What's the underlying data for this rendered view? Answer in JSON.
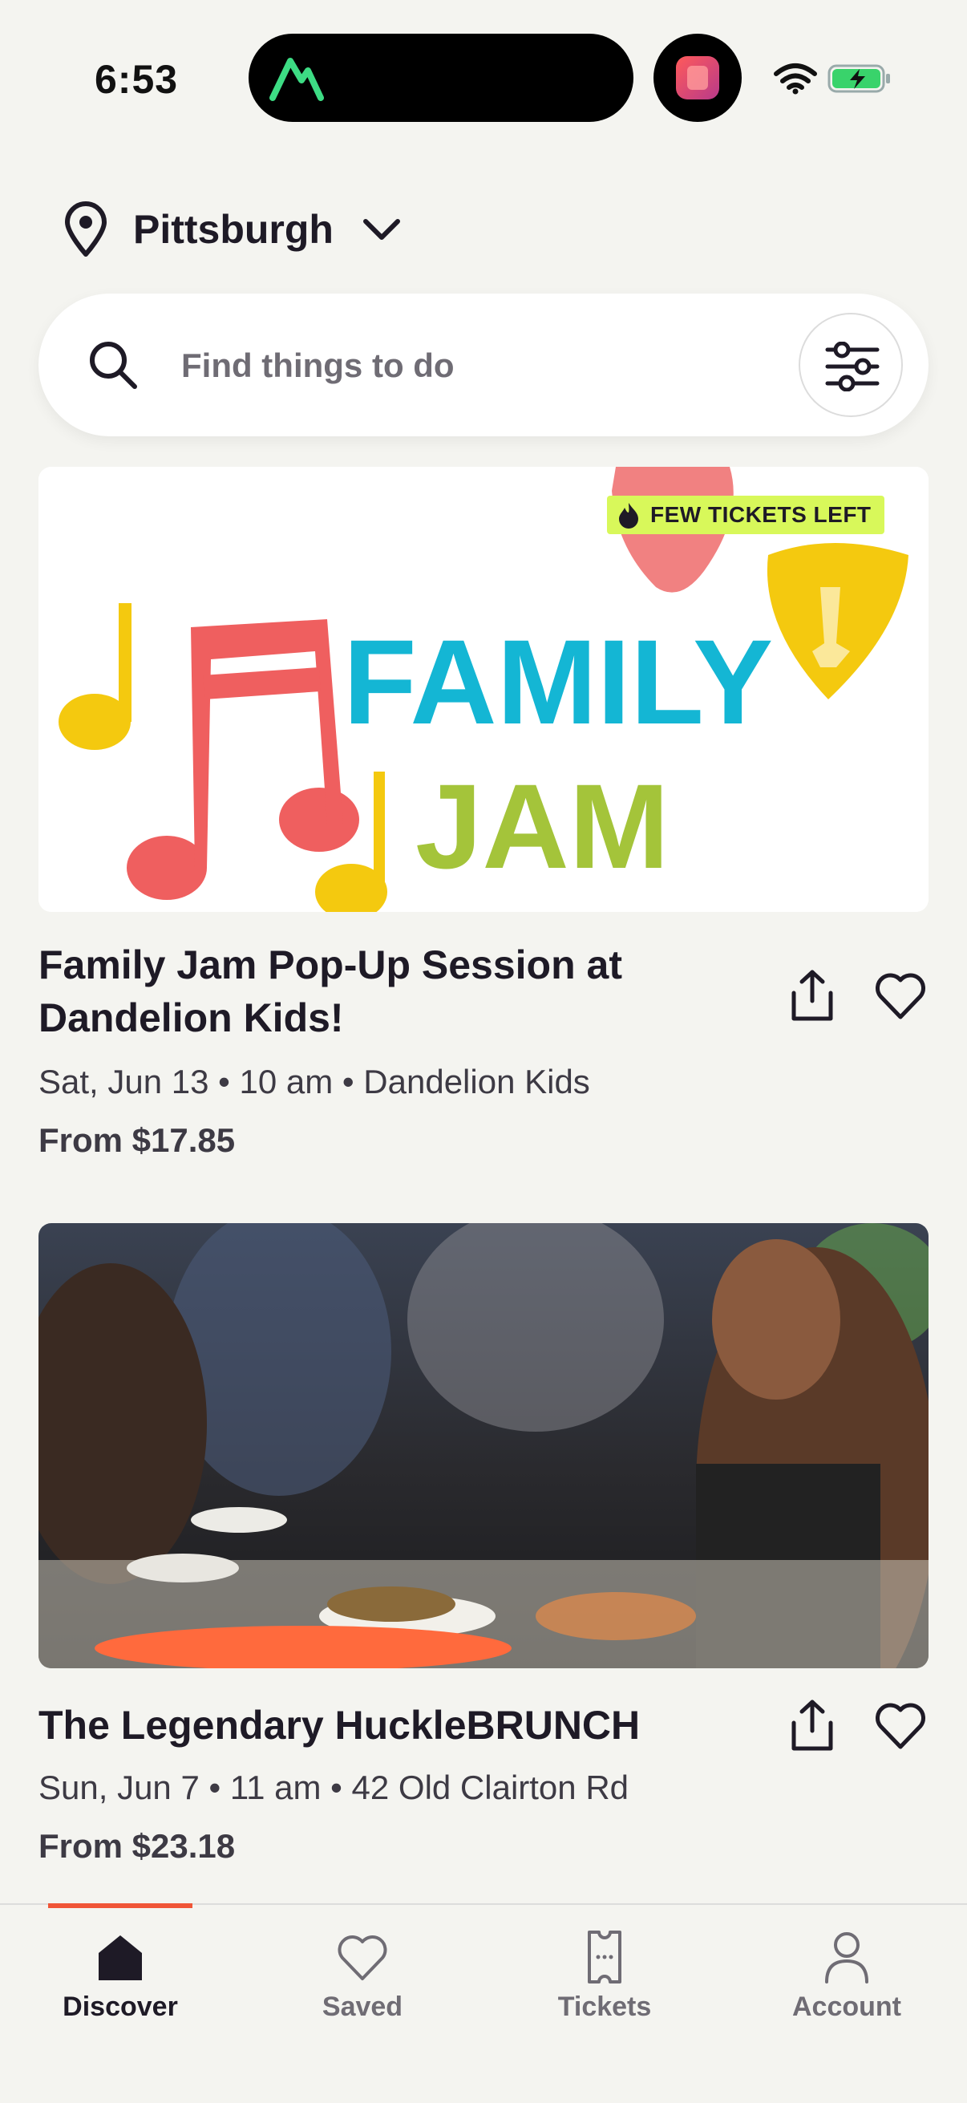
{
  "status_bar": {
    "time": "6:53"
  },
  "location": {
    "city": "Pittsburgh"
  },
  "search": {
    "placeholder": "Find things to do"
  },
  "events": [
    {
      "badge": "FEW TICKETS LEFT",
      "image_words": [
        "FAMILY",
        "JAM"
      ],
      "title": "Family Jam Pop-Up Session at Dandelion Kids!",
      "meta": "Sat, Jun 13 • 10 am • Dandelion Kids",
      "price": "From $17.85"
    },
    {
      "title": "The Legendary HuckleBRUNCH",
      "meta": "Sun, Jun 7 • 11 am • 42 Old Clairton Rd",
      "price": "From $23.18"
    }
  ],
  "nav": {
    "items": [
      {
        "label": "Discover",
        "icon": "home-icon",
        "active": true
      },
      {
        "label": "Saved",
        "icon": "heart-icon",
        "active": false
      },
      {
        "label": "Tickets",
        "icon": "ticket-icon",
        "active": false
      },
      {
        "label": "Account",
        "icon": "person-icon",
        "active": false
      }
    ]
  },
  "colors": {
    "background": "#f4f4f0",
    "accent": "#f05537",
    "badge": "#d8f85a",
    "text": "#1e1a26",
    "muted": "#6f6c74"
  }
}
